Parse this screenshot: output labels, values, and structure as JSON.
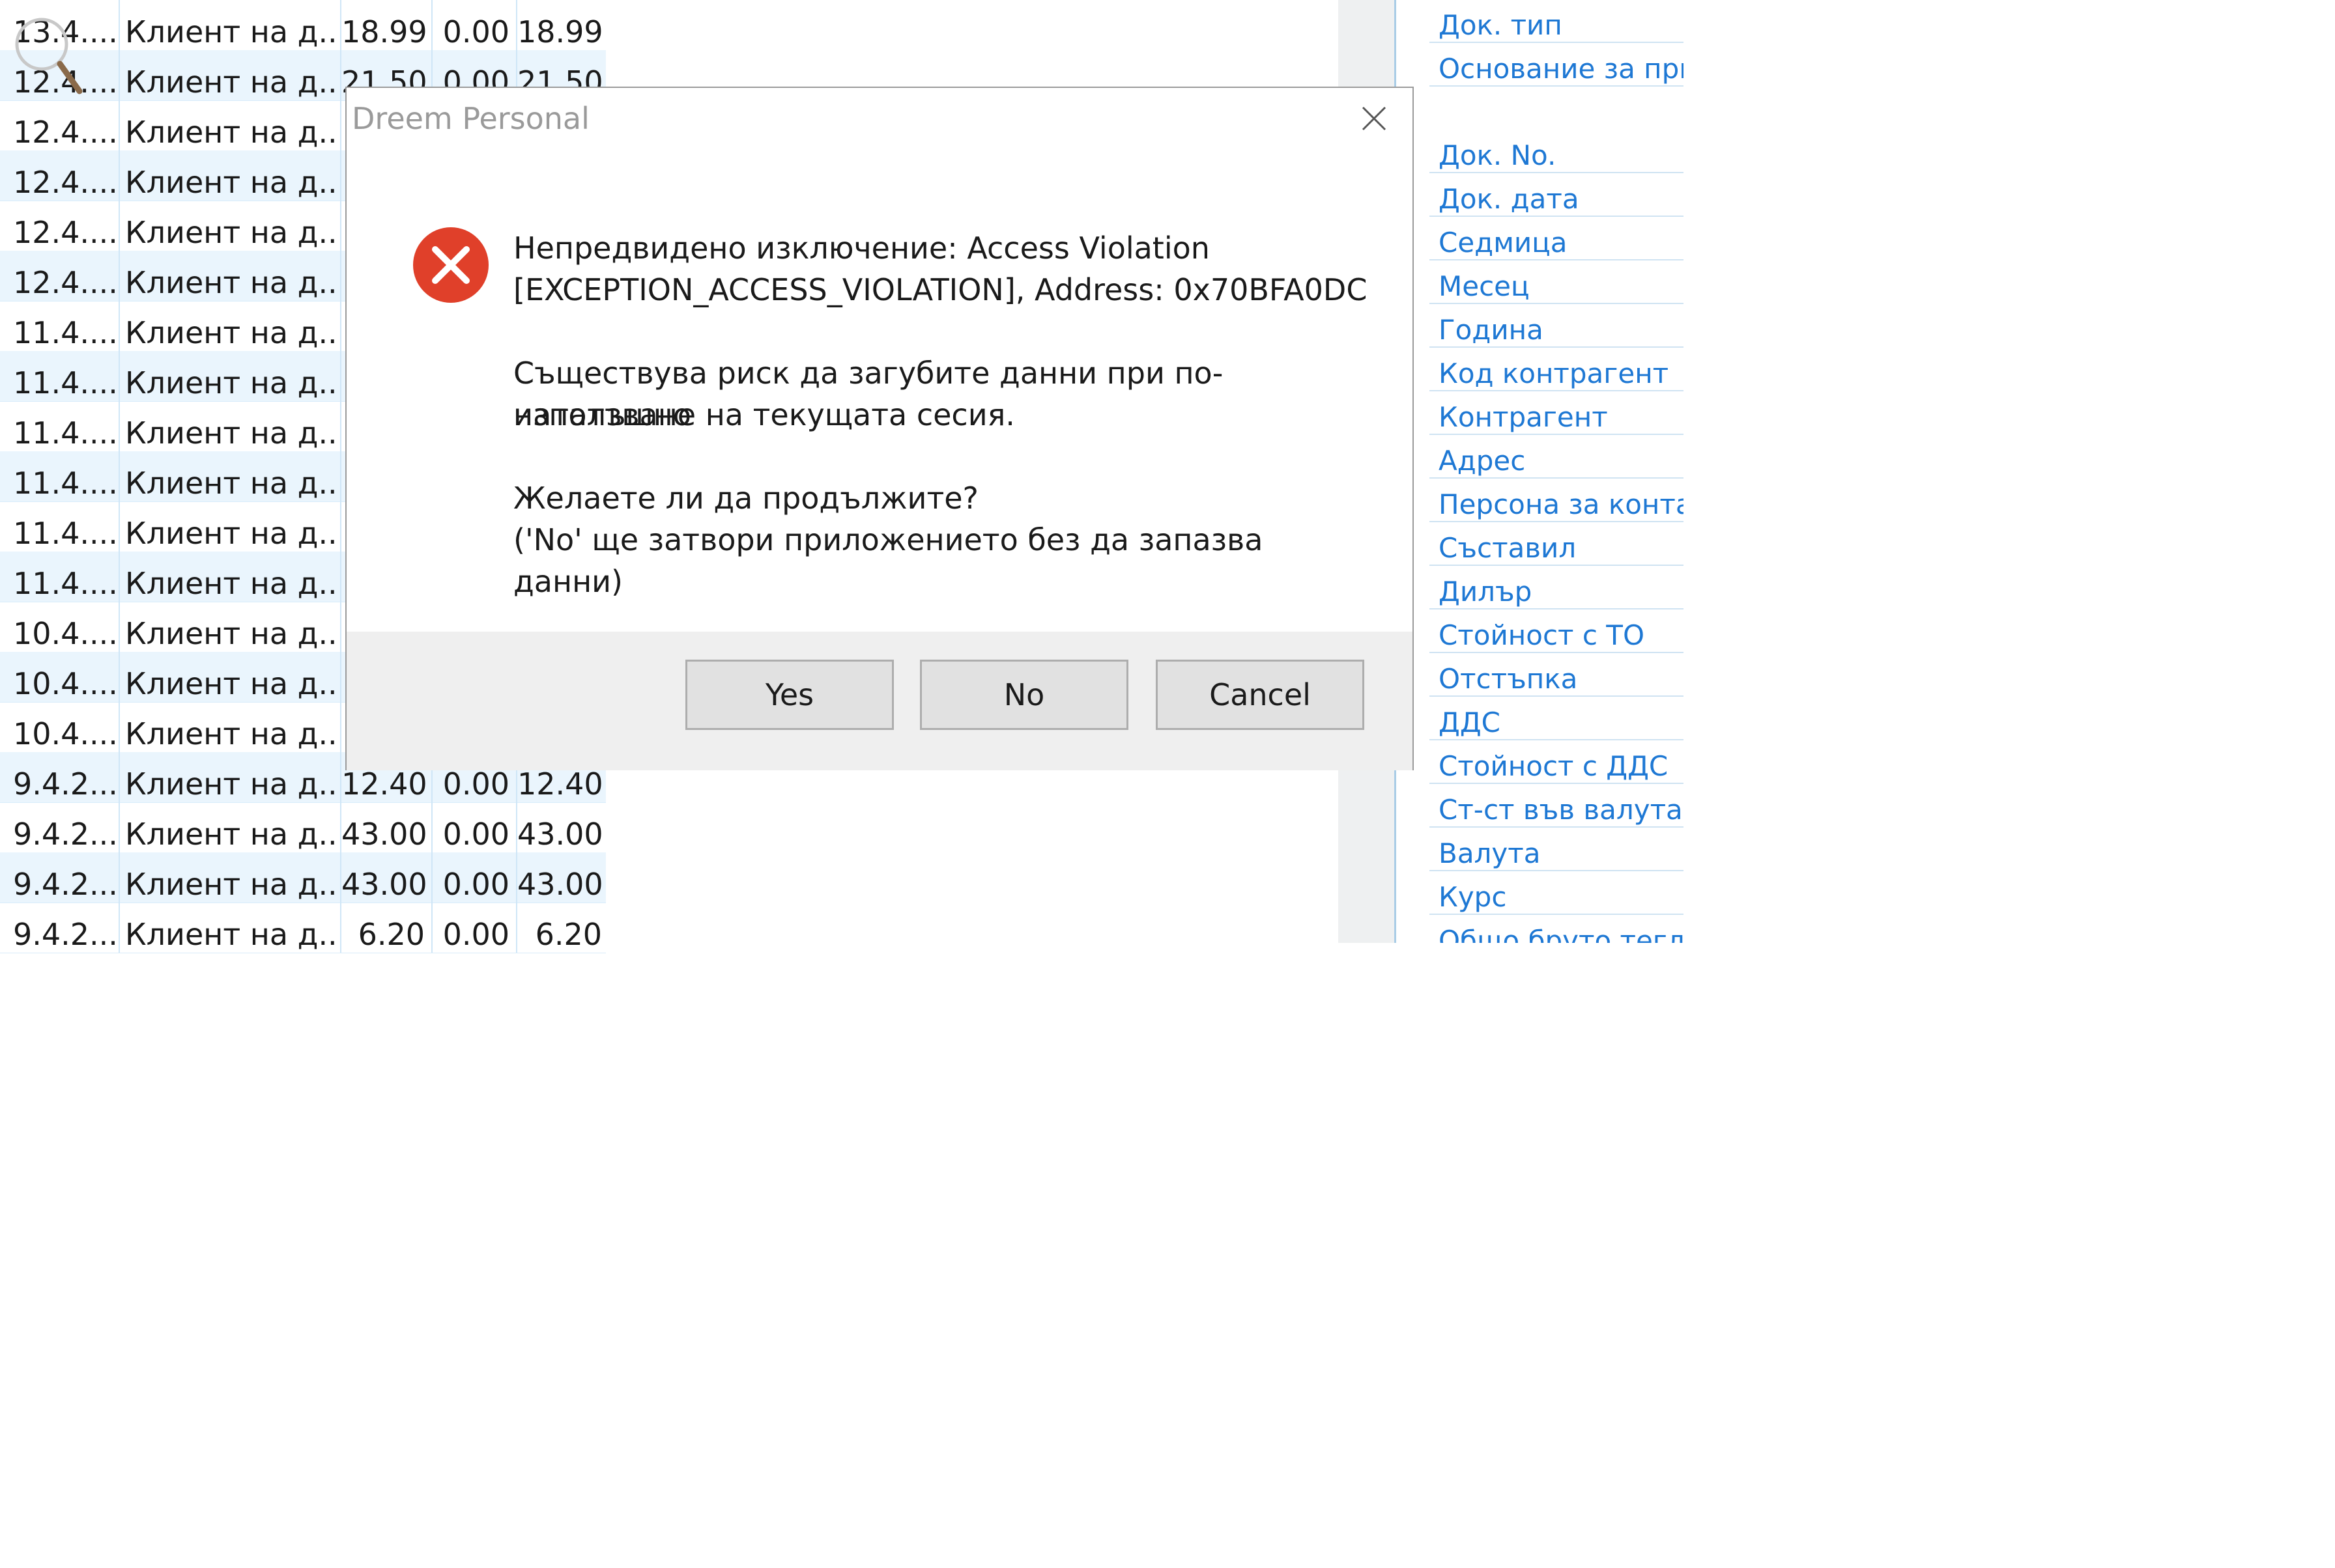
{
  "grid_rows": [
    {
      "date": "13.4....",
      "client": "Клиент на д...",
      "v1": "18.99",
      "v2": "0.00",
      "v3": "18.99"
    },
    {
      "date": "12.4....",
      "client": "Клиент на д...",
      "v1": "21.50",
      "v2": "0.00",
      "v3": "21.50"
    },
    {
      "date": "12.4....",
      "client": "Клиент на д...",
      "v1": "",
      "v2": "",
      "v3": ""
    },
    {
      "date": "12.4....",
      "client": "Клиент на д...",
      "v1": "",
      "v2": "",
      "v3": ""
    },
    {
      "date": "12.4....",
      "client": "Клиент на д...",
      "v1": "",
      "v2": "",
      "v3": ""
    },
    {
      "date": "12.4....",
      "client": "Клиент на д...",
      "v1": "",
      "v2": "",
      "v3": ""
    },
    {
      "date": "11.4....",
      "client": "Клиент на д...",
      "v1": "",
      "v2": "",
      "v3": ""
    },
    {
      "date": "11.4....",
      "client": "Клиент на д...",
      "v1": "",
      "v2": "",
      "v3": ""
    },
    {
      "date": "11.4....",
      "client": "Клиент на д...",
      "v1": "",
      "v2": "",
      "v3": ""
    },
    {
      "date": "11.4....",
      "client": "Клиент на д...",
      "v1": "",
      "v2": "",
      "v3": ""
    },
    {
      "date": "11.4....",
      "client": "Клиент на д...",
      "v1": "",
      "v2": "",
      "v3": ""
    },
    {
      "date": "11.4....",
      "client": "Клиент на д...",
      "v1": "",
      "v2": "",
      "v3": ""
    },
    {
      "date": "10.4....",
      "client": "Клиент на д...",
      "v1": "",
      "v2": "",
      "v3": ""
    },
    {
      "date": "10.4....",
      "client": "Клиент на д...",
      "v1": "",
      "v2": "",
      "v3": ""
    },
    {
      "date": "10.4....",
      "client": "Клиент на д...",
      "v1": "",
      "v2": "",
      "v3": ""
    },
    {
      "date": "9.4.2...",
      "client": "Клиент на д...",
      "v1": "12.40",
      "v2": "0.00",
      "v3": "12.40"
    },
    {
      "date": "9.4.2...",
      "client": "Клиент на д...",
      "v1": "43.00",
      "v2": "0.00",
      "v3": "43.00"
    },
    {
      "date": "9.4.2...",
      "client": "Клиент на д...",
      "v1": "43.00",
      "v2": "0.00",
      "v3": "43.00"
    },
    {
      "date": "9.4.2...",
      "client": "Клиент на д...",
      "v1": "6.20",
      "v2": "0.00",
      "v3": "6.20"
    }
  ],
  "field_list": [
    "Док. тип",
    "Основание за прил",
    "Док. No.",
    "Док. дата",
    "Седмица",
    "Месец",
    "Година",
    "Код контрагент",
    "Контрагент",
    "Адрес",
    "Персона за контакт",
    "Съставил",
    "Дилър",
    "Стойност с ТО",
    "Отстъпка",
    "ДДС",
    "Стойност с ДДС",
    "Ст-ст във валута",
    "Валута",
    "Курс",
    "Общо бруто тегло"
  ],
  "dialog": {
    "title": "Dreem Personal",
    "icon": "error-icon",
    "message_line1": "Непредвидено изключение: Access Violation",
    "message_line2": "[EXCEPTION_ACCESS_VIOLATION], Address: 0x70BFA0DC",
    "message_line3": "Съществува риск да загубите данни при по-нататъшно",
    "message_line4": "използване на текущата сесия.",
    "message_line5": "Желаете ли да продължите?",
    "message_line6": "('No' ще затвори приложението без да запазва данни)",
    "buttons": {
      "yes": "Yes",
      "no": "No",
      "cancel": "Cancel"
    }
  },
  "colors": {
    "link_blue": "#1e78d4",
    "error_red": "#e0402a",
    "row_alt": "#eaf5fd"
  }
}
